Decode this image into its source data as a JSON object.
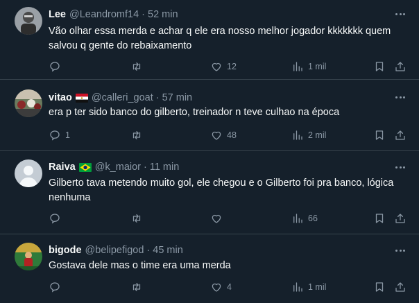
{
  "tweets": [
    {
      "name": "Lee",
      "handle": "@Leandromf14",
      "dot": "·",
      "time": "52 min",
      "text": "Vão olhar essa merda e achar q ele era nosso melhor jogador kkkkkkk quem salvou q gente do rebaixamento",
      "replies": "",
      "retweets": "",
      "likes": "12",
      "views": "1 mil"
    },
    {
      "name": "vitao",
      "handle": "@calleri_goat",
      "dot": "·",
      "time": "57 min",
      "text": "era p ter sido banco do gilberto, treinador n teve culhao na época",
      "replies": "1",
      "retweets": "",
      "likes": "48",
      "views": "2 mil"
    },
    {
      "name": "Raiva",
      "handle": "@k_maior",
      "dot": "·",
      "time": "11 min",
      "text": "Gilberto tava metendo muito gol, ele chegou e o Gilberto foi pra banco, lógica nenhuma",
      "replies": "",
      "retweets": "",
      "likes": "",
      "views": "66"
    },
    {
      "name": "bigode",
      "handle": "@belipefigod",
      "dot": "·",
      "time": "45 min",
      "text": "Gostava dele mas o time era uma merda",
      "replies": "",
      "retweets": "",
      "likes": "4",
      "views": "1 mil"
    }
  ],
  "colors": {
    "background": "#15202b",
    "text": "#f7f9f9",
    "muted": "#8b98a5",
    "divider": "#38444d"
  }
}
